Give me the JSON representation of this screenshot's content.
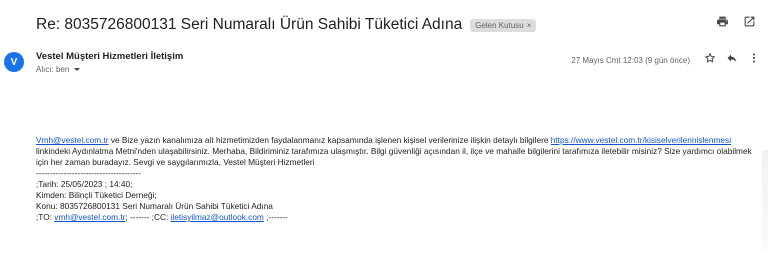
{
  "header": {
    "subject": "Re: 8035726800131 Seri Numaralı Ürün Sahibi Tüketici Adına",
    "label": "Gelen Kutusu",
    "label_close": "×",
    "icons": [
      "print-icon",
      "open-new-window-icon"
    ]
  },
  "message": {
    "avatar_letter": "V",
    "sender": "Vestel Müşteri Hizmetleri İletişim",
    "recipient": "Alıcı: ben",
    "date": "27 Mayıs Cmt 12:03 (9 gün önce)",
    "action_icons": [
      "star-icon",
      "reply-icon",
      "more-vert-icon"
    ],
    "body": {
      "link_email": "Vmh@vestel.com.tr",
      "text1": " ve Bize yazın kanalımıza ait hizmetimizden faydalanmanız kapsamında işlenen kişisel verilerinize ilişkin detaylı bilgilere ",
      "link_url": "https://www.vestel.com.tr/kisiselverilerinislenmesi",
      "text2": " linkindeki Aydınlatma Metni'nden ulaşabilirsiniz. Merhaba, Bildiriminiz tarafımıza ulaşmıştır. Bilgi güvenliği açısından il, ilçe ve mahalle bilgilerini tarafımıza iletebilir misiniz? Size yardımcı olabilmek için her zaman buradayız. Sevgi ve saygılarımızla, Vestel Müşteri Hizmetleri",
      "separator": "--------------------------------------",
      "tarih": ";Tarih: 25/05/2023 ; 14:40;",
      "kimden": "Kimden: Bilinçli Tüketici Derneği;",
      "konu": "Konu: 8035726800131 Seri Numaralı Ürün Sahibi Tüketici Adına",
      "to_prefix": ";TO: ",
      "to_email": "vmh@vestel.com.tr",
      "to_mid": "; ------- ;CC: ",
      "cc_email": "iletisyilmaz@outlook.com",
      "cc_suffix": " ;-------"
    }
  }
}
